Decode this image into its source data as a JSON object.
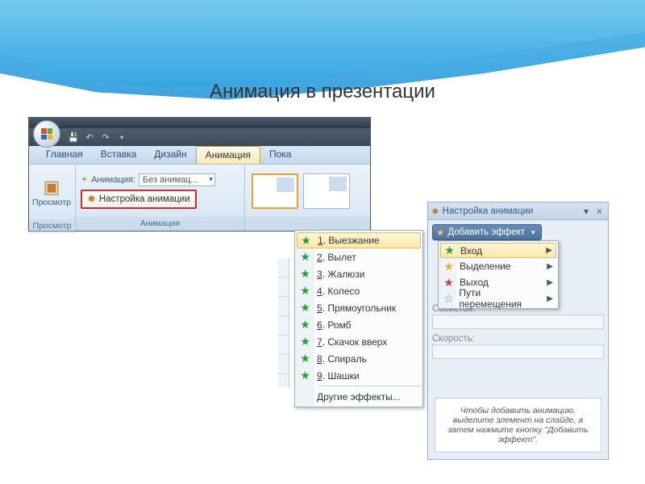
{
  "slide_title": "Анимация в презентации",
  "qat": {
    "save": "save-icon",
    "undo": "undo-icon",
    "redo": "redo-icon"
  },
  "tabs": [
    "Главная",
    "Вставка",
    "Дизайн",
    "Анимация",
    "Пока"
  ],
  "active_tab": "Анимация",
  "ribbon": {
    "preview_btn": "Просмотр",
    "preview_group": "Просмотр",
    "anim_label": "Анимация:",
    "anim_value": "Без анимац...",
    "settings_btn": "Настройка анимации",
    "anim_group": "Анимация"
  },
  "effects_menu": [
    {
      "num": "1",
      "label": "Выезжание",
      "hl": true
    },
    {
      "num": "2",
      "label": "Вылет"
    },
    {
      "num": "3",
      "label": "Жалюзи"
    },
    {
      "num": "4",
      "label": "Колесо"
    },
    {
      "num": "5",
      "label": "Прямоугольник"
    },
    {
      "num": "6",
      "label": "Ромб"
    },
    {
      "num": "7",
      "label": "Скачок вверх"
    },
    {
      "num": "8",
      "label": "Спираль"
    },
    {
      "num": "9",
      "label": "Шашки"
    }
  ],
  "effects_other": "Другие эффекты...",
  "taskpane": {
    "title": "Настройка анимации",
    "add_effect": "Добавить эффект",
    "type_menu": [
      {
        "label": "Вход",
        "cls": "",
        "hl": true
      },
      {
        "label": "Выделение",
        "cls": "y"
      },
      {
        "label": "Выход",
        "cls": "r"
      },
      {
        "label": "Пути перемещения",
        "cls": "w"
      }
    ],
    "prop_label": "Свойство:",
    "speed_label": "Скорость:",
    "hint": "Чтобы добавить анимацию, выделите элемент на слайде, а затем нажмите кнопку \"Добавить эффект\"."
  }
}
